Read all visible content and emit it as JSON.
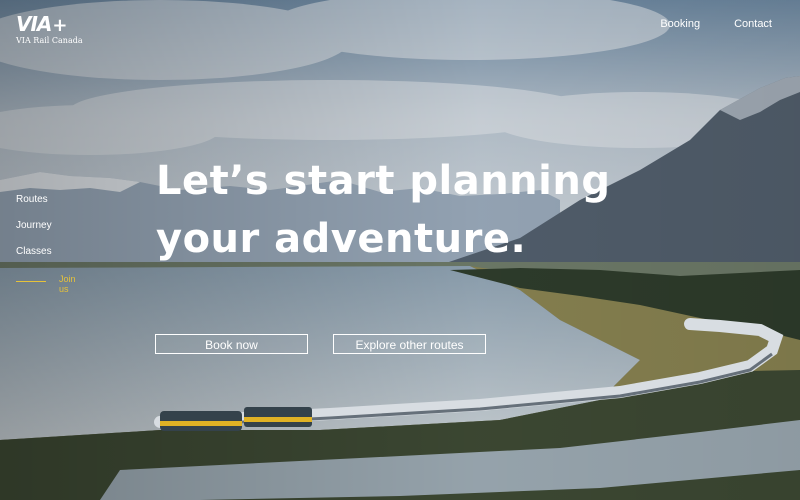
{
  "logo": {
    "mark": "VIA",
    "plus": "+",
    "subtitle": "VIA Rail Canada"
  },
  "topnav": {
    "booking": "Booking",
    "contact": "Contact"
  },
  "sidenav": {
    "items": [
      "Routes",
      "Journey",
      "Classes"
    ],
    "join": "Join us"
  },
  "hero": {
    "line1": "Let’s start planning",
    "line2": "your adventure."
  },
  "buttons": {
    "book_now": "Book now",
    "explore": "Explore other routes"
  },
  "colors": {
    "accent": "#e6c23a",
    "text": "#ffffff"
  }
}
